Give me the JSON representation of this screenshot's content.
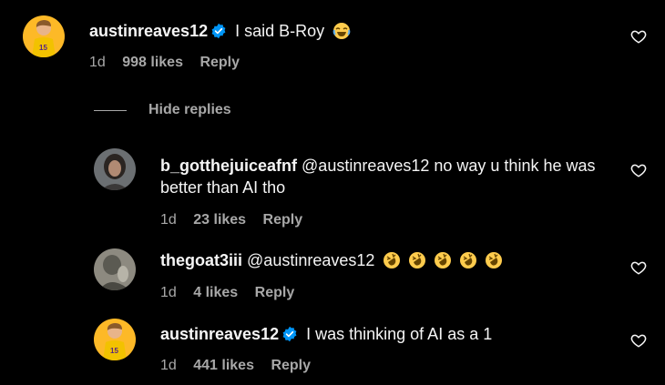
{
  "comments": [
    {
      "username": "austinreaves12",
      "verified": true,
      "text": "I said B-Roy",
      "emoji": "😂",
      "age": "1d",
      "likes": "998 likes",
      "reply": "Reply"
    },
    {
      "username": "b_gotthejuiceafnf",
      "verified": false,
      "text": "@austinreaves12 no way u think he was better than AI tho",
      "age": "1d",
      "likes": "23 likes",
      "reply": "Reply"
    },
    {
      "username": "thegoat3iii",
      "verified": false,
      "text": "@austinreaves12",
      "emoji": "🤣🤣🤣🤣🤣",
      "age": "1d",
      "likes": "4 likes",
      "reply": "Reply"
    },
    {
      "username": "austinreaves12",
      "verified": true,
      "text": "I was thinking of AI as a 1",
      "age": "1d",
      "likes": "441 likes",
      "reply": "Reply"
    }
  ],
  "hide_replies_label": "Hide replies",
  "colors": {
    "background": "#000000",
    "text": "#f5f5f5",
    "secondary": "#a8a8a8",
    "verified_blue": "#0095f6",
    "jersey_gold": "#fdb927"
  },
  "icons": {
    "like": "heart-outline-icon",
    "verified": "verified-badge-icon"
  }
}
